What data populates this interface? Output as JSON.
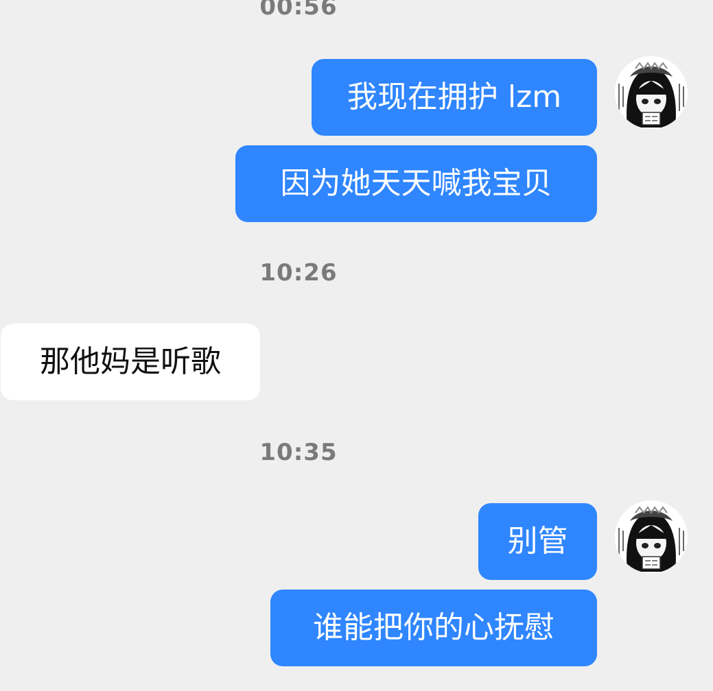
{
  "timestamps": [
    "00:56",
    "10:26",
    "10:35"
  ],
  "messages": [
    {
      "side": "out",
      "text": "我现在拥护 lzm"
    },
    {
      "side": "out",
      "text": "因为她天天喊我宝贝"
    },
    {
      "side": "in",
      "text": "那他妈是听歌"
    },
    {
      "side": "out",
      "text": "别管"
    },
    {
      "side": "out",
      "text": "谁能把你的心抚慰"
    }
  ],
  "avatar": {
    "icon": "anime-girl-avatar-icon"
  },
  "colors": {
    "background": "#efefef",
    "outgoing_bubble": "#2f86ff",
    "incoming_bubble": "#ffffff",
    "timestamp": "#7a7a7a"
  }
}
